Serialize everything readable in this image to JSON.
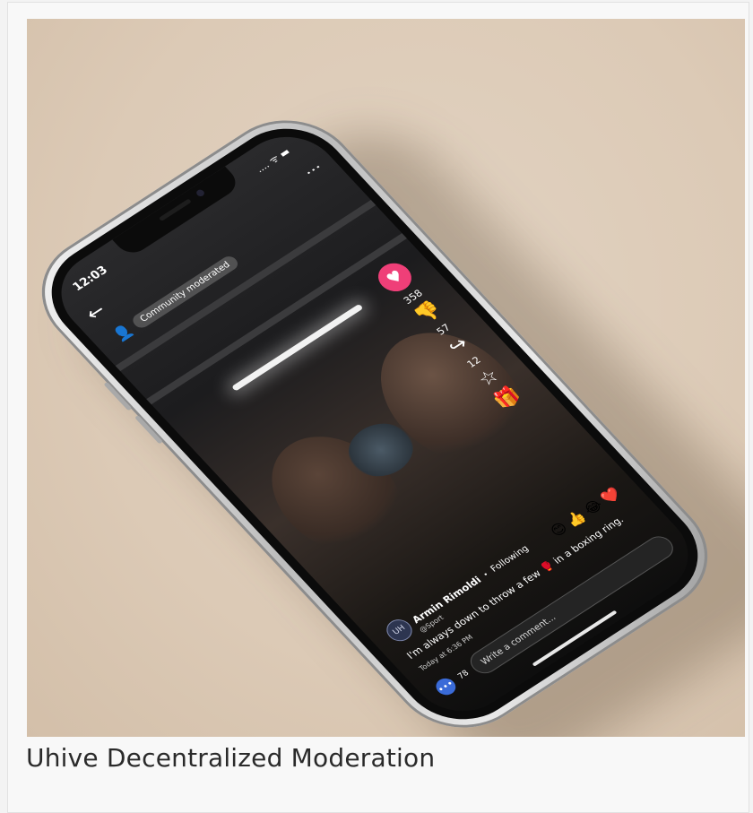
{
  "caption": "Uhive Decentralized Moderation",
  "phone": {
    "status_time": "12:03",
    "status_icons": ".... ᯤ ▬",
    "back_icon": "←",
    "more_icon": "⋮",
    "moderation_icon": "👤",
    "moderation_label": "Community moderated",
    "actions": {
      "like_icon": "♥",
      "like_count": "358",
      "dislike_icon": "👎",
      "dislike_count": "57",
      "share_icon": "↪",
      "share_count": "12",
      "favorite_icon": "☆",
      "gift_icon": "🎁"
    },
    "post": {
      "avatar_text": "UH",
      "author_name": "Armin Rimoldi",
      "dot": "•",
      "follow_status": "Following",
      "handle": "@Sport",
      "text": "I'm always down to throw a few 🥊 in a boxing ring.",
      "timestamp": "Today at 6:36 PM"
    },
    "reactions": [
      "😊",
      "👍",
      "😂",
      "❤️"
    ],
    "comments": {
      "bubble_icon": "•••",
      "count": "78",
      "placeholder": "Write a comment..."
    }
  },
  "colors": {
    "background": "#dccab6",
    "like": "#ef3f78",
    "comment": "#3a6bd8"
  }
}
